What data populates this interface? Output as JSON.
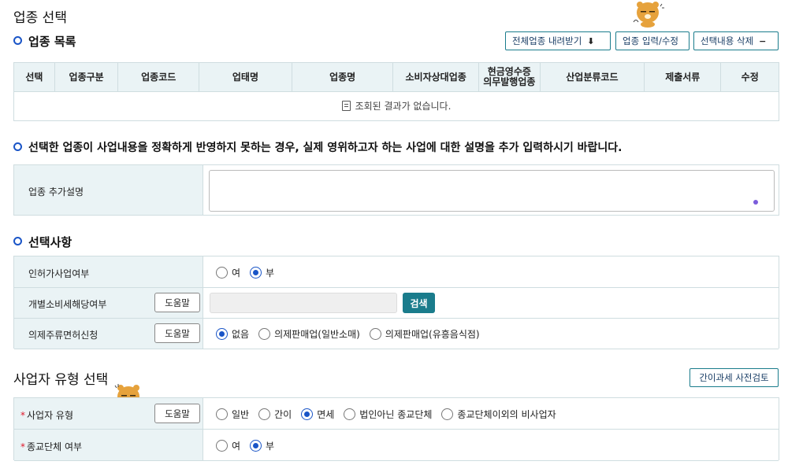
{
  "page_title": "업종 선택",
  "industry_list": {
    "heading": "업종 목록",
    "buttons": {
      "download_all": "전체업종 내려받기",
      "input_edit": "업종 입력/수정",
      "delete_selected": "선택내용 삭제"
    },
    "columns": [
      "선택",
      "업종구분",
      "업종코드",
      "업태명",
      "업종명",
      "소비자상대업종",
      "현금영수증\n의무발행업종",
      "산업분류코드",
      "제출서류",
      "수정"
    ],
    "empty_message": "조회된 결과가 없습니다."
  },
  "notice": "선택한 업종이 사업내용을 정확하게 반영하지 못하는 경우, 실제 영위하고자 하는 사업에 대한 설명을 추가 입력하시기 바랍니다.",
  "extra_description": {
    "label": "업종 추가설명",
    "value": ""
  },
  "options_section": {
    "heading": "선택사항",
    "license": {
      "label": "인허가사업여부",
      "options": [
        "여",
        "부"
      ],
      "selected": "부"
    },
    "excise": {
      "label": "개별소비세해당여부",
      "help": "도움말",
      "value": "",
      "search": "검색"
    },
    "liquor": {
      "label": "의제주류면허신청",
      "help": "도움말",
      "options": [
        "없음",
        "의제판매업(일반소매)",
        "의제판매업(유흥음식점)"
      ],
      "selected": "없음"
    }
  },
  "biz_type_section": {
    "heading": "사업자 유형 선택",
    "simplified_check": "간이과세 사전검토",
    "biz_type": {
      "required_mark": "*",
      "label": "사업자 유형",
      "help": "도움말",
      "options": [
        "일반",
        "간이",
        "면세",
        "법인아닌 종교단체",
        "종교단체이외의 비사업자"
      ],
      "selected": "면세"
    },
    "religious": {
      "required_mark": "*",
      "label": "종교단체 여부",
      "options": [
        "여",
        "부"
      ],
      "selected": "부"
    }
  },
  "colors": {
    "accent_teal": "#1a7c8c",
    "accent_blue": "#1a55c7",
    "header_bg": "#eaf3f5",
    "required": "#e0182b"
  }
}
